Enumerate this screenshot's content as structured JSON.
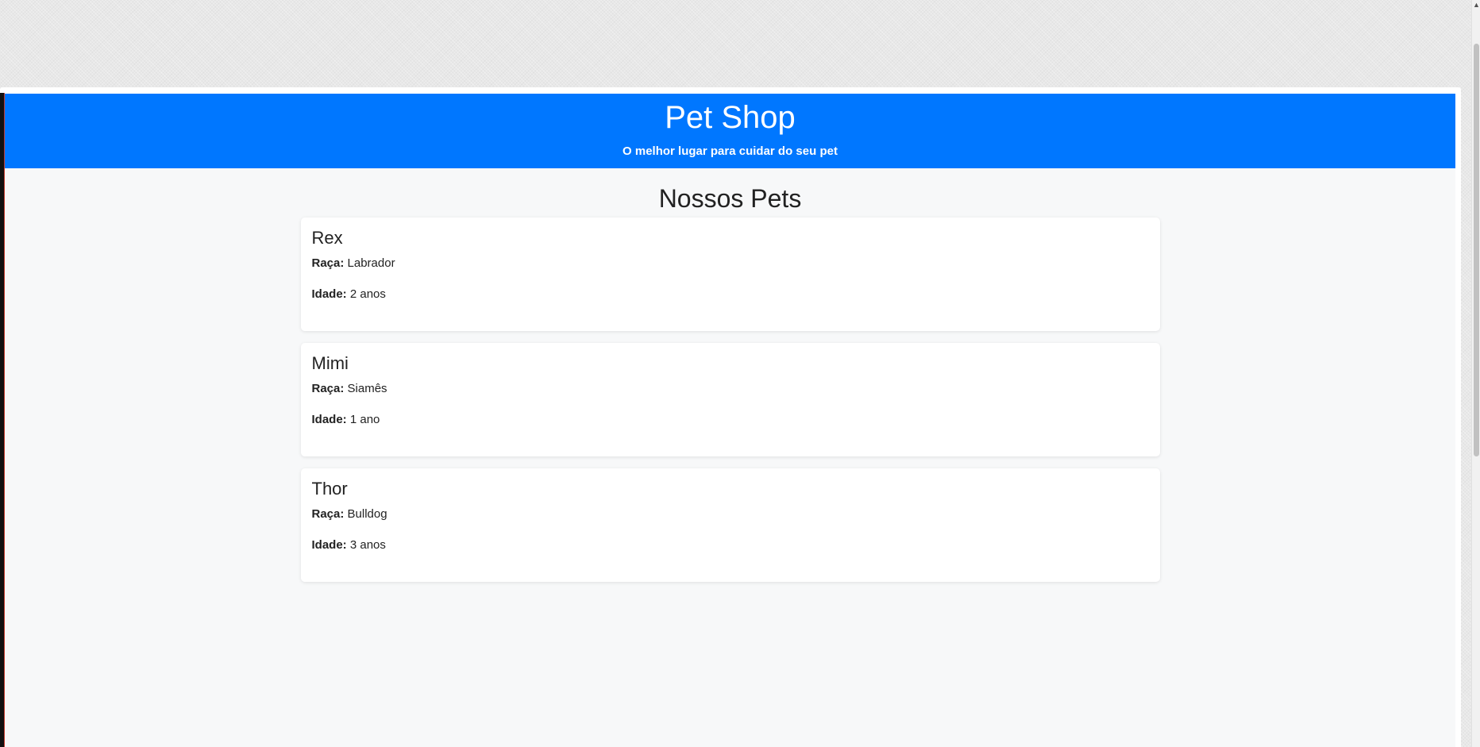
{
  "header": {
    "title": "Pet Shop",
    "tagline": "O melhor lugar para cuidar do seu pet"
  },
  "main": {
    "section_title": "Nossos Pets",
    "pets": [
      {
        "name": "Rex",
        "breed_label": "Raça:",
        "breed": "Labrador",
        "age_label": "Idade:",
        "age": "2 anos"
      },
      {
        "name": "Mimi",
        "breed_label": "Raça:",
        "breed": "Siamês",
        "age_label": "Idade:",
        "age": "1 ano"
      },
      {
        "name": "Thor",
        "breed_label": "Raça:",
        "breed": "Bulldog",
        "age_label": "Idade:",
        "age": "3 anos"
      }
    ]
  },
  "colors": {
    "header_bg": "#0077ff",
    "content_bg": "#f7f8f9",
    "card_bg": "#ffffff",
    "text": "#222222"
  },
  "icons": {
    "scroll_up": "chevron-up-icon"
  }
}
